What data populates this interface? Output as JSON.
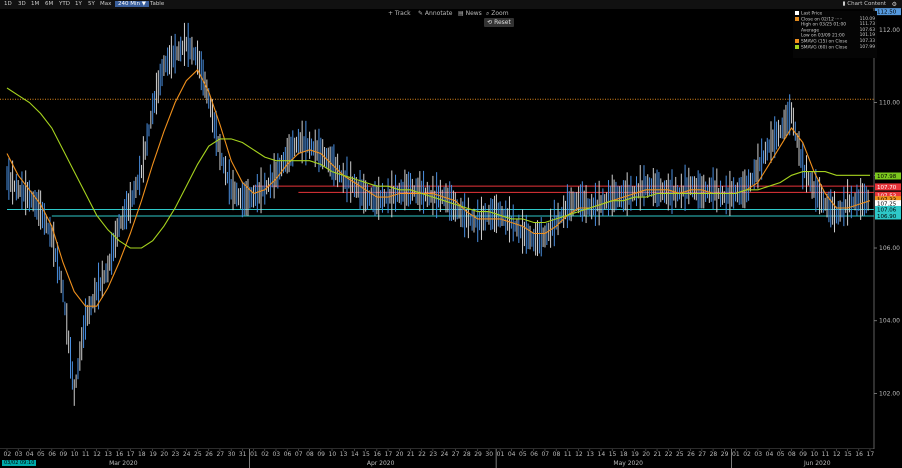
{
  "timeframes": [
    {
      "label": "1D",
      "selected": false
    },
    {
      "label": "3D",
      "selected": false
    },
    {
      "label": "1M",
      "selected": false
    },
    {
      "label": "6M",
      "selected": false
    },
    {
      "label": "YTD",
      "selected": false
    },
    {
      "label": "1Y",
      "selected": false
    },
    {
      "label": "5Y",
      "selected": false
    },
    {
      "label": "Max",
      "selected": false
    },
    {
      "label": "240 Min ▼",
      "selected": true
    },
    {
      "label": "Table",
      "selected": false
    }
  ],
  "toolbar": {
    "track": "+ Track",
    "annotate": "✎ Annotate",
    "news": "▤ News",
    "zoom": "⌕ Zoom",
    "reset": "⟲ Reset"
  },
  "chart_content_label": "▮ Chart Content",
  "legend": [
    {
      "label": "Last Price",
      "value": "",
      "color": "#ffffff"
    },
    {
      "label": "Close on 02/12 ·····",
      "value": "110.09",
      "color": "#e08a1e"
    },
    {
      "label": "High on 03/25 01:00",
      "value": "111.73",
      "color": ""
    },
    {
      "label": "Average",
      "value": "107.63",
      "color": ""
    },
    {
      "label": "Low on 03/09 21:00",
      "value": "101.19",
      "color": ""
    },
    {
      "label": "SMAVG (15)   on Close",
      "value": "107.33",
      "color": "#f0901c"
    },
    {
      "label": "SMAVG (60)   on Close",
      "value": "107.99",
      "color": "#a6d31e"
    }
  ],
  "right_tags": [
    {
      "text": "112.50",
      "value": 112.5,
      "bg": "#5599dd",
      "fg": "#000"
    },
    {
      "text": "107.98",
      "value": 107.98,
      "bg": "#7bc61e",
      "fg": "#000"
    },
    {
      "text": "107.70",
      "value": 107.68,
      "bg": "#e8343a",
      "fg": "#fff"
    },
    {
      "text": "107.53",
      "value": 107.45,
      "bg": "#e8343a",
      "fg": "#fff"
    },
    {
      "text": "107.33",
      "value": 107.33,
      "bg": "#f0901c",
      "fg": "#000"
    },
    {
      "text": "107.25",
      "value": 107.22,
      "bg": "#ffffff",
      "fg": "#000"
    },
    {
      "text": "107.06",
      "value": 107.06,
      "bg": "#2ec8c8",
      "fg": "#000"
    },
    {
      "text": "106.90",
      "value": 106.88,
      "bg": "#2ec8c8",
      "fg": "#000"
    }
  ],
  "chart_data": {
    "type": "line",
    "title": "",
    "xlabel": "",
    "ylabel": "",
    "ylim": [
      100.5,
      112.6
    ],
    "yticks": [
      102.0,
      104.0,
      106.0,
      108.0,
      110.0,
      112.0
    ],
    "ytick_labels": [
      "102.00",
      "104.00",
      "106.00",
      "108.00",
      "110.00",
      "112.00"
    ],
    "grid": false,
    "x_day_labels": [
      "02",
      "03",
      "04",
      "05",
      "06",
      "09",
      "10",
      "11",
      "12",
      "13",
      "16",
      "17",
      "18",
      "19",
      "20",
      "23",
      "24",
      "25",
      "26",
      "27",
      "30",
      "31",
      "01",
      "02",
      "03",
      "06",
      "07",
      "08",
      "09",
      "10",
      "13",
      "14",
      "15",
      "16",
      "17",
      "20",
      "21",
      "22",
      "23",
      "24",
      "27",
      "28",
      "29",
      "30",
      "01",
      "04",
      "05",
      "06",
      "07",
      "08",
      "11",
      "12",
      "13",
      "14",
      "15",
      "18",
      "19",
      "20",
      "21",
      "22",
      "25",
      "26",
      "27",
      "28",
      "29",
      "01",
      "02",
      "03",
      "04",
      "05",
      "08",
      "09",
      "10",
      "11",
      "12",
      "15",
      "16",
      "17"
    ],
    "x_month_labels": [
      {
        "label": "Mar 2020",
        "index": 10
      },
      {
        "label": "Apr 2020",
        "index": 33
      },
      {
        "label": "May 2020",
        "index": 55
      },
      {
        "label": "Jun 2020",
        "index": 72
      }
    ],
    "cursor_date": "03/02 09:10",
    "reference_lines": [
      {
        "name": "Close on 02/12",
        "value": 110.09,
        "color": "#e08a1e",
        "style": "dotted"
      },
      {
        "name": "resistance",
        "value": 107.7,
        "color": "#e8343a",
        "style": "solid",
        "start_index": 22
      },
      {
        "name": "resistance",
        "value": 107.53,
        "color": "#e8343a",
        "style": "solid",
        "start_index": 26
      },
      {
        "name": "support",
        "value": 107.06,
        "color": "#2ec8c8",
        "style": "solid",
        "start_index": 0
      },
      {
        "name": "support",
        "value": 106.88,
        "color": "#2ec8c8",
        "style": "solid",
        "start_index": 4
      }
    ],
    "series": [
      {
        "name": "Last Price",
        "color": "#4a8fe0",
        "values": [
          107.9,
          107.6,
          107.4,
          107.0,
          106.3,
          104.8,
          102.0,
          104.0,
          104.8,
          105.4,
          106.6,
          107.2,
          108.1,
          109.8,
          111.0,
          111.3,
          111.6,
          111.2,
          110.1,
          108.6,
          107.6,
          107.3,
          107.4,
          107.6,
          108.0,
          108.5,
          108.9,
          108.8,
          108.6,
          108.3,
          107.9,
          107.7,
          107.4,
          107.3,
          107.4,
          107.5,
          107.6,
          107.5,
          107.4,
          107.4,
          107.1,
          106.8,
          106.7,
          106.9,
          106.9,
          106.7,
          106.4,
          106.2,
          106.3,
          106.7,
          107.1,
          107.3,
          107.1,
          107.2,
          107.4,
          107.4,
          107.5,
          107.7,
          107.6,
          107.5,
          107.5,
          107.7,
          107.5,
          107.6,
          107.4,
          107.5,
          107.6,
          108.2,
          108.8,
          109.2,
          109.7,
          108.2,
          107.6,
          107.2,
          106.9,
          107.2,
          107.3,
          107.3
        ]
      },
      {
        "name": "SMAVG (15) on Close",
        "color": "#f0901c",
        "values": [
          108.6,
          108.0,
          107.6,
          107.2,
          106.6,
          105.6,
          104.8,
          104.4,
          104.4,
          104.9,
          105.6,
          106.4,
          107.3,
          108.3,
          109.2,
          110.0,
          110.6,
          110.9,
          110.3,
          109.4,
          108.4,
          107.8,
          107.5,
          107.6,
          107.9,
          108.3,
          108.6,
          108.7,
          108.6,
          108.3,
          108.0,
          107.8,
          107.6,
          107.4,
          107.4,
          107.5,
          107.5,
          107.5,
          107.5,
          107.4,
          107.3,
          107.0,
          106.8,
          106.8,
          106.8,
          106.7,
          106.6,
          106.4,
          106.4,
          106.6,
          106.9,
          107.1,
          107.1,
          107.2,
          107.3,
          107.4,
          107.5,
          107.6,
          107.6,
          107.6,
          107.5,
          107.6,
          107.6,
          107.5,
          107.5,
          107.5,
          107.6,
          107.8,
          108.3,
          108.8,
          109.3,
          108.9,
          108.1,
          107.5,
          107.1,
          107.1,
          107.2,
          107.3
        ]
      },
      {
        "name": "SMAVG (60) on Close",
        "color": "#a6d31e",
        "values": [
          110.4,
          110.2,
          110.0,
          109.7,
          109.3,
          108.7,
          108.1,
          107.5,
          106.9,
          106.5,
          106.2,
          106.0,
          106.0,
          106.2,
          106.6,
          107.1,
          107.7,
          108.3,
          108.8,
          109.0,
          109.0,
          108.9,
          108.7,
          108.5,
          108.4,
          108.4,
          108.4,
          108.4,
          108.3,
          108.1,
          108.0,
          107.9,
          107.8,
          107.7,
          107.7,
          107.6,
          107.6,
          107.5,
          107.4,
          107.3,
          107.2,
          107.1,
          107.0,
          107.0,
          106.9,
          106.8,
          106.8,
          106.7,
          106.7,
          106.8,
          106.9,
          107.0,
          107.1,
          107.2,
          107.3,
          107.3,
          107.4,
          107.4,
          107.5,
          107.5,
          107.5,
          107.5,
          107.5,
          107.5,
          107.5,
          107.5,
          107.6,
          107.6,
          107.7,
          107.8,
          108.0,
          108.1,
          108.1,
          108.1,
          108.0,
          108.0,
          108.0,
          108.0
        ]
      }
    ]
  }
}
